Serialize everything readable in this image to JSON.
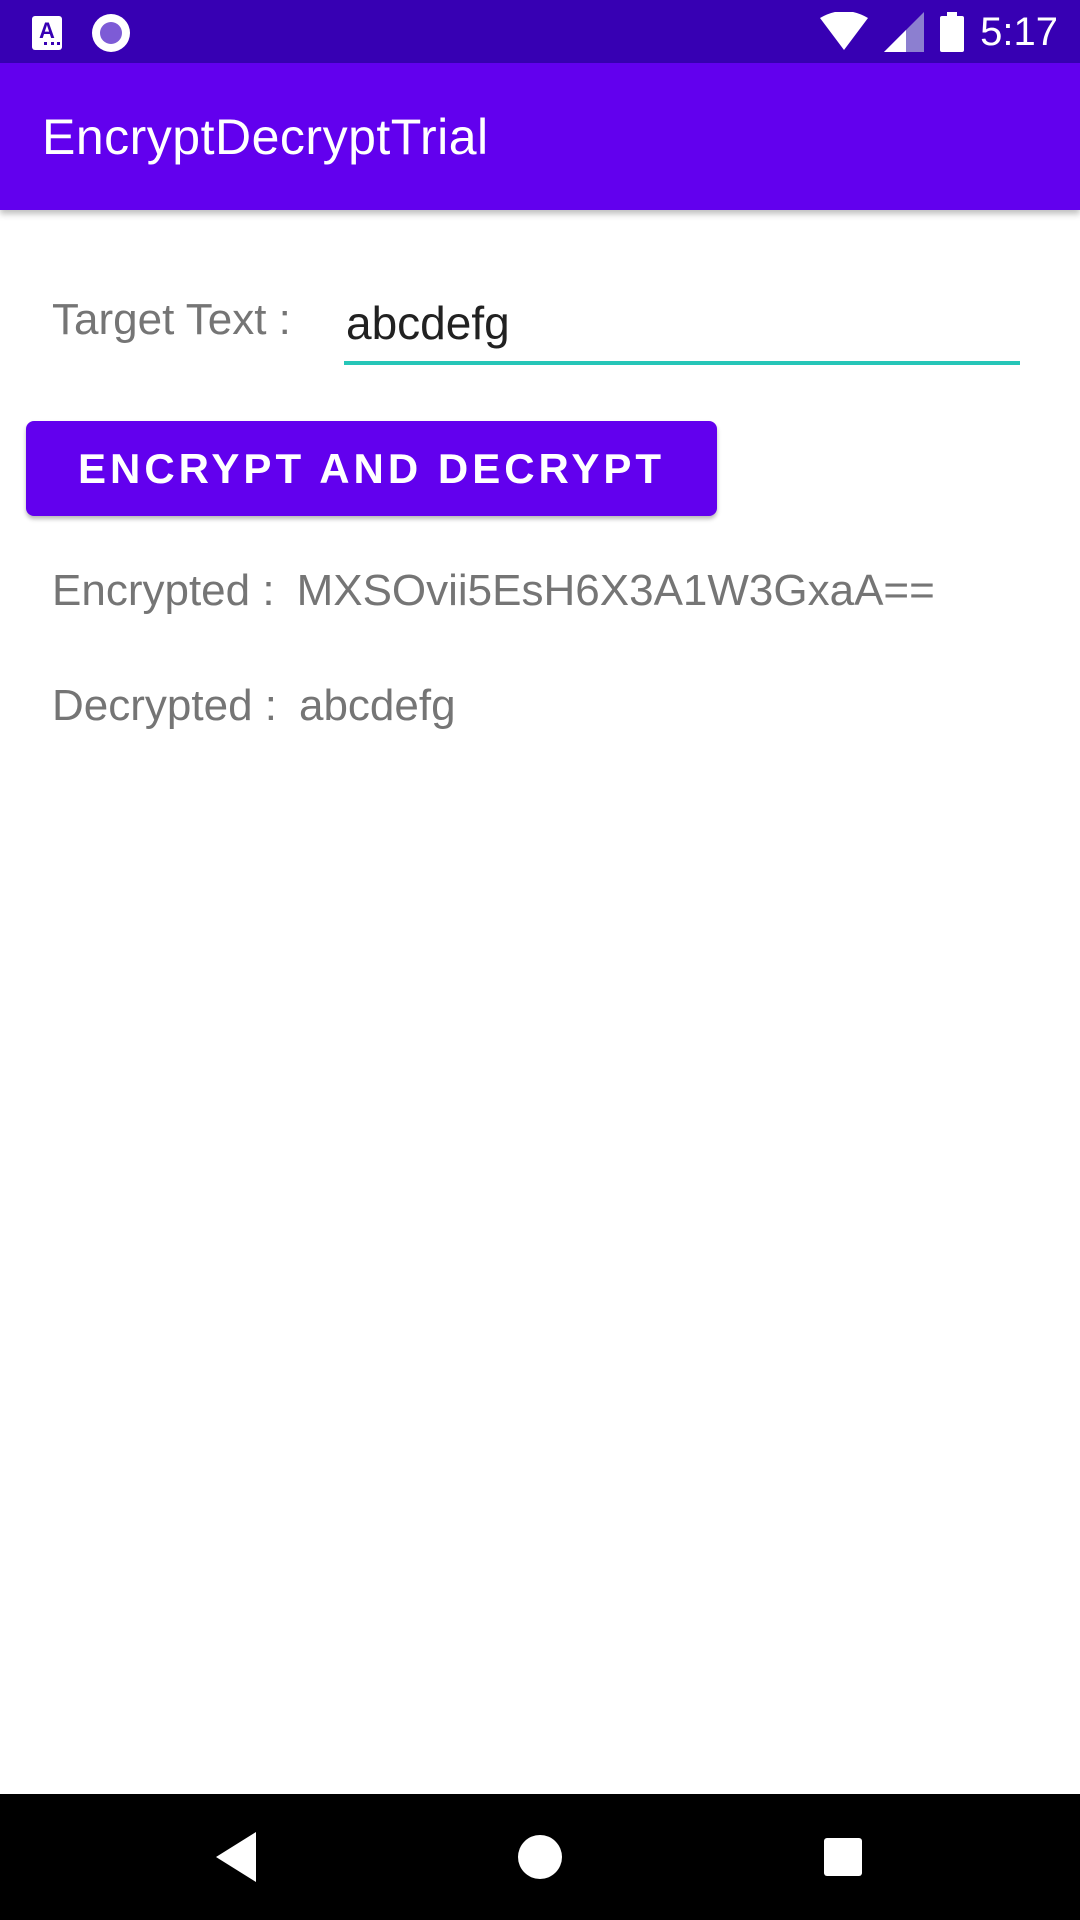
{
  "status_bar": {
    "time": "5:17",
    "left_icons": [
      "accessibility-icon",
      "record-icon"
    ],
    "right_icons": [
      "wifi-icon",
      "signal-icon",
      "battery-icon"
    ],
    "a_glyph": "A"
  },
  "app_bar": {
    "title": "EncryptDecryptTrial"
  },
  "form": {
    "target_label": "Target Text :",
    "target_value": "abcdefg",
    "button_label": "ENCRYPT AND DECRYPT"
  },
  "results": {
    "encrypted_label": "Encrypted :",
    "encrypted_value": "MXSOvii5EsH6X3A1W3GxaA==",
    "decrypted_label": "Decrypted :",
    "decrypted_value": "abcdefg"
  },
  "nav_bar": {
    "buttons": [
      "back-icon",
      "home-icon",
      "recent-apps-icon"
    ]
  },
  "colors": {
    "status_bar": "#3700b3",
    "primary": "#6200ee",
    "input_underline": "#26c6b8",
    "label_text": "#757575"
  }
}
